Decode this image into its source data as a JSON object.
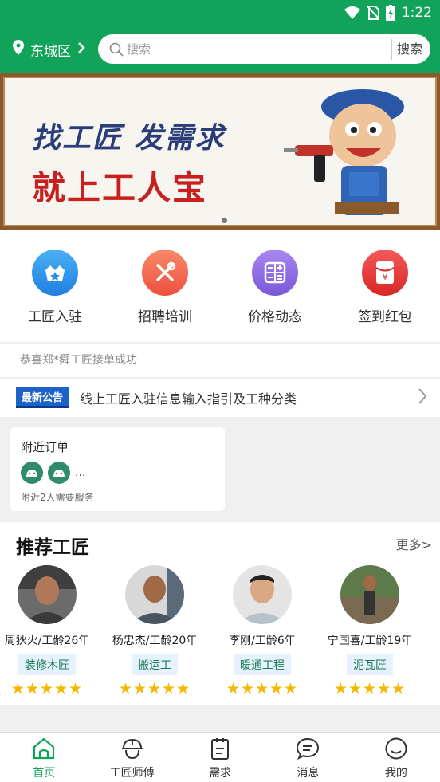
{
  "status_bar": {
    "time": "1:22"
  },
  "header": {
    "location": "东城区",
    "search_placeholder": "搜索",
    "search_button": "搜索"
  },
  "banner": {
    "line1": "找工匠 发需求",
    "line2": "就上工人宝"
  },
  "quick_actions": [
    {
      "label": "工匠入驻",
      "color": "#2b8fe8",
      "icon": "crown-icon"
    },
    {
      "label": "招聘培训",
      "color": "#f2684e",
      "icon": "tools-icon"
    },
    {
      "label": "价格动态",
      "color": "#8d67e3",
      "icon": "calculator-icon"
    },
    {
      "label": "签到红包",
      "color": "#e83a3a",
      "icon": "red-envelope-icon"
    }
  ],
  "notice": "恭喜郑*舜工匠接单成功",
  "news": {
    "tag": "最新公告",
    "text": "线上工匠入驻信息输入指引及工种分类"
  },
  "nearby": {
    "title": "附近订单",
    "more": "...",
    "caption": "附近2人需要服务"
  },
  "recommend": {
    "title": "推荐工匠",
    "more": "更多>",
    "workers": [
      {
        "name": "周狄火/工龄26年",
        "skill": "装修木匠",
        "rating": 5
      },
      {
        "name": "杨忠杰/工龄20年",
        "skill": "搬运工",
        "rating": 5
      },
      {
        "name": "李刚/工龄6年",
        "skill": "暖通工程",
        "rating": 5
      },
      {
        "name": "宁国喜/工龄19年",
        "skill": "泥瓦匠",
        "rating": 5
      }
    ]
  },
  "tabs": [
    {
      "label": "首页",
      "icon": "home-icon"
    },
    {
      "label": "工匠师傅",
      "icon": "worker-helmet-icon"
    },
    {
      "label": "需求",
      "icon": "clipboard-icon"
    },
    {
      "label": "消息",
      "icon": "message-icon"
    },
    {
      "label": "我的",
      "icon": "profile-icon"
    }
  ],
  "accent_color": "#12a35a"
}
